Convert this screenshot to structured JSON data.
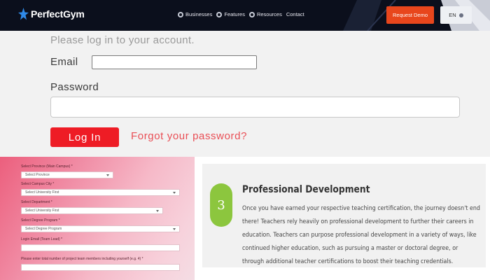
{
  "nav": {
    "brand": "PerfectGym",
    "items": [
      {
        "label": "Businesses"
      },
      {
        "label": "Features"
      },
      {
        "label": "Resources"
      },
      {
        "label": "Contact"
      }
    ],
    "request_demo": "Request Demo",
    "language": "EN"
  },
  "login": {
    "heading": "Please log in to your account.",
    "email_label": "Email",
    "email_value": "",
    "password_label": "Password",
    "password_value": "",
    "login_button": "Log In",
    "forgot_link": "Forgot your password?"
  },
  "registration": {
    "fields": [
      {
        "label": "Select Province (Main Campus) *",
        "value": "Select Province"
      },
      {
        "label": "Select Campus City *",
        "value": "Select University First"
      },
      {
        "label": "Select Department *",
        "value": "Select University First"
      },
      {
        "label": "Select Degree Program *",
        "value": "Select Degree Program"
      },
      {
        "label": "Login Email (Team Lead) *",
        "value": ""
      },
      {
        "label": "Please enter total number of project team members including yourself (e.g. 4) *",
        "value": ""
      }
    ]
  },
  "info_card": {
    "step_number": "3",
    "title": "Professional Development",
    "body": "Once you have earned your respective teaching certification, the journey doesn't end there! Teachers rely heavily on professional development to further their careers in education. Teachers can purpose professional development in a variety of ways, like continued higher education, such as pursuing a master or doctoral degree, or through additional teacher certifications to boost their teaching credentials."
  },
  "colors": {
    "nav_bg": "#0b0f1c",
    "accent_orange": "#e8461c",
    "login_red": "#ee1c25",
    "forgot_red": "#e94e55",
    "step_green": "#8cc63e"
  }
}
